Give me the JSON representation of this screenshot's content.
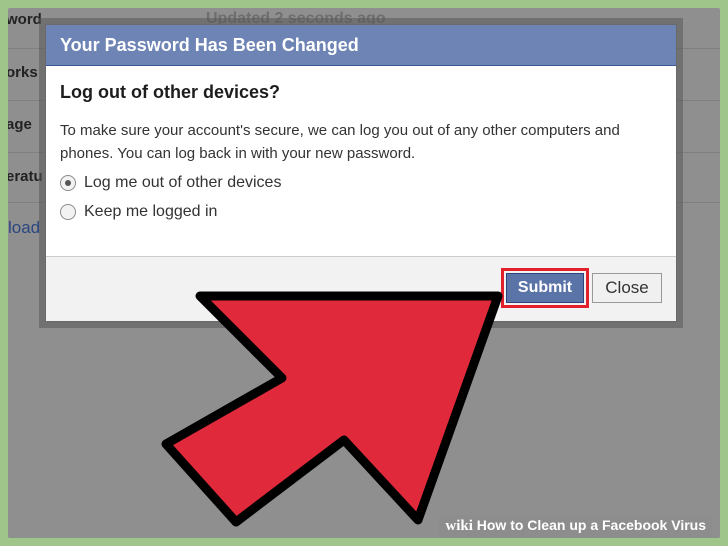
{
  "background": {
    "rows": [
      "word",
      "orks",
      "age",
      "eratu"
    ],
    "updated_text": "Updated 2 seconds ago",
    "link_text": "load"
  },
  "dialog": {
    "title": "Your Password Has Been Changed",
    "heading": "Log out of other devices?",
    "description": "To make sure your account's secure, we can log you out of any other computers and phones. You can log back in with your new password.",
    "options": [
      {
        "label": "Log me out of other devices",
        "selected": true
      },
      {
        "label": "Keep me logged in",
        "selected": false
      }
    ],
    "submit_label": "Submit",
    "close_label": "Close"
  },
  "arrow": {
    "color": "#e02a3c",
    "outline": "#000000",
    "icon": "pointer-arrow-icon"
  },
  "watermark": {
    "brand": "wiki",
    "title": "How to Clean up a Facebook Virus"
  },
  "colors": {
    "header": "#6d84b4",
    "submit": "#5b74a8",
    "highlight": "#e0202a"
  }
}
